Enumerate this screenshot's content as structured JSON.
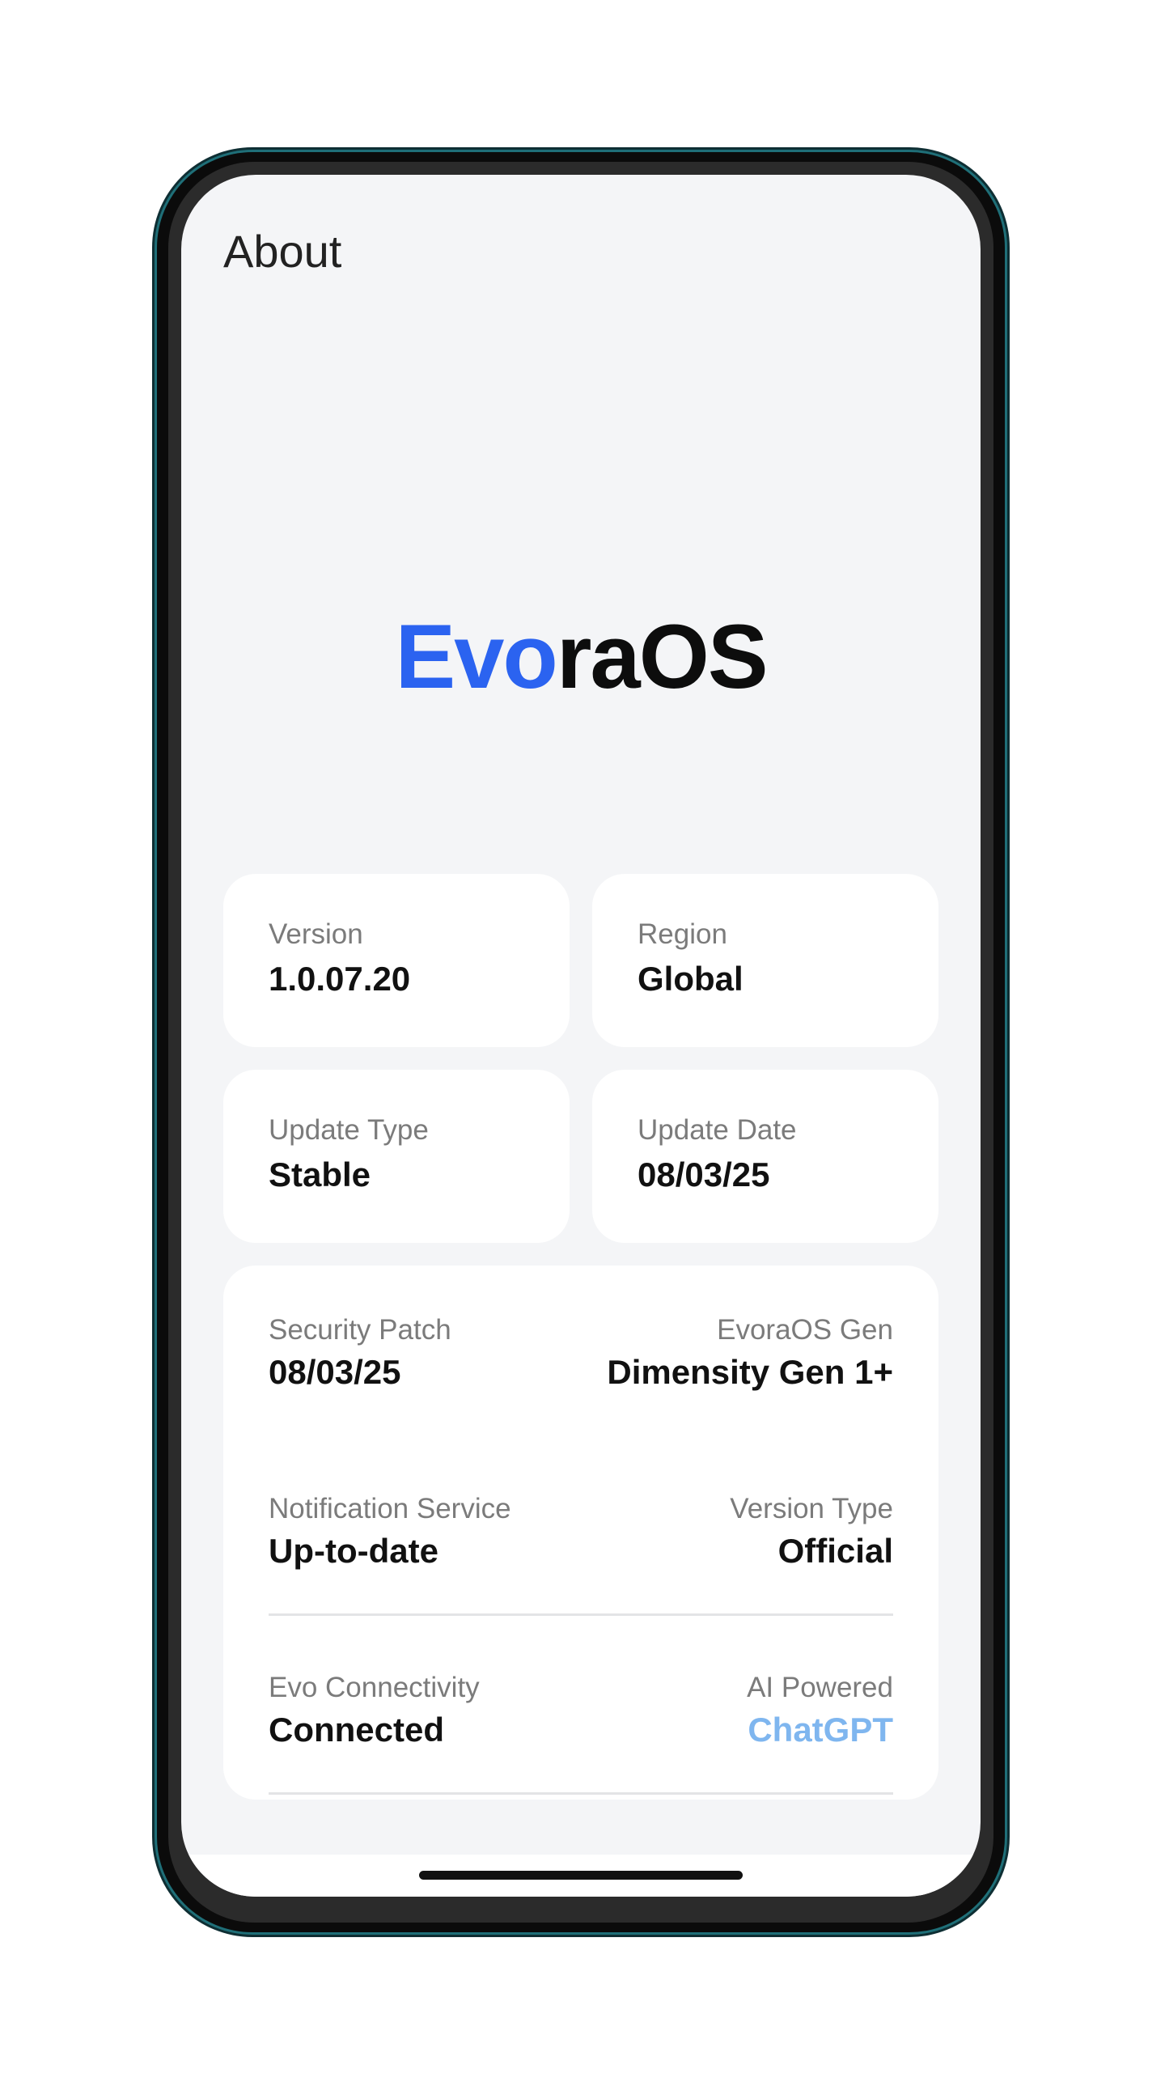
{
  "header": {
    "title": "About"
  },
  "logo": {
    "accent_text": "Evo",
    "rest_text": "raOS",
    "accent_color": "#2b63f0"
  },
  "cards": {
    "version": {
      "label": "Version",
      "value": "1.0.07.20"
    },
    "region": {
      "label": "Region",
      "value": "Global"
    },
    "update_type": {
      "label": "Update Type",
      "value": "Stable"
    },
    "update_date": {
      "label": "Update Date",
      "value": "08/03/25"
    }
  },
  "details": {
    "security_patch": {
      "label": "Security Patch",
      "value": "08/03/25"
    },
    "evoraos_gen": {
      "label": "EvoraOS Gen",
      "value": "Dimensity Gen 1+"
    },
    "notification_service": {
      "label": "Notification Service",
      "value": "Up-to-date"
    },
    "version_type": {
      "label": "Version Type",
      "value": "Official"
    },
    "evo_connectivity": {
      "label": "Evo Connectivity",
      "value": "Connected"
    },
    "ai_powered": {
      "label": "AI Powered",
      "value": "ChatGPT",
      "color": "#7fb6ef"
    }
  }
}
